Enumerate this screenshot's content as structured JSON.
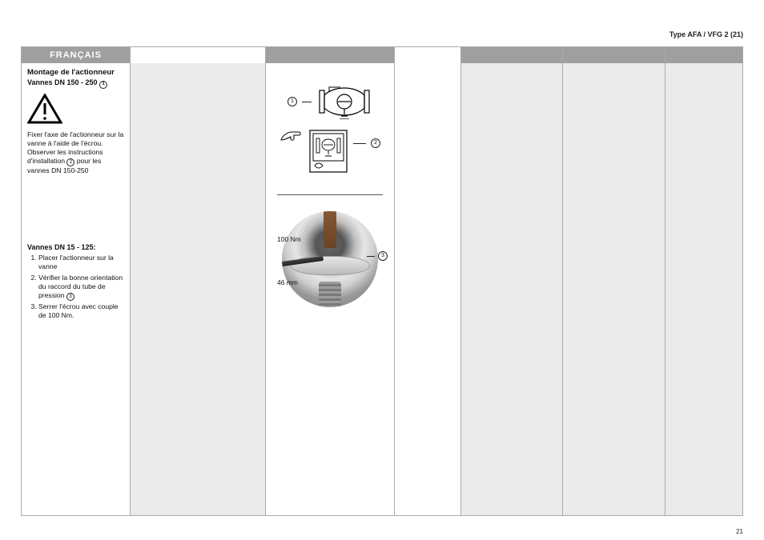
{
  "header": {
    "doc_type": "Type AFA / VFG 2 (21)"
  },
  "footer": {
    "page_number": "21"
  },
  "leftcol": {
    "header": "FRANÇAIS",
    "title": "Montage de l'actionneur",
    "subtitle_prefix": "Vannes DN 150 - 250",
    "callout1": "1",
    "warning_text": "Fixer l'axe de l'actionneur sur la vanne à l'aide de l'écrou. Observer les instructions d'installation",
    "callout2": "2",
    "warning_text_tail": "pour les vannes DN 150-250",
    "subhead": "Vannes DN 15 - 125:",
    "steps": [
      "Placer l'actionneur sur la vanne",
      "Vérifier la bonne orientation du raccord du tube de pression",
      "Serrer l'écrou avec couple de 100 Nm."
    ],
    "callout3": "3"
  },
  "midcol": {
    "callout1": "1",
    "callout2": "2",
    "callout3": "3",
    "torque_label": "100 Nm",
    "wrench_label": "46 mm"
  }
}
